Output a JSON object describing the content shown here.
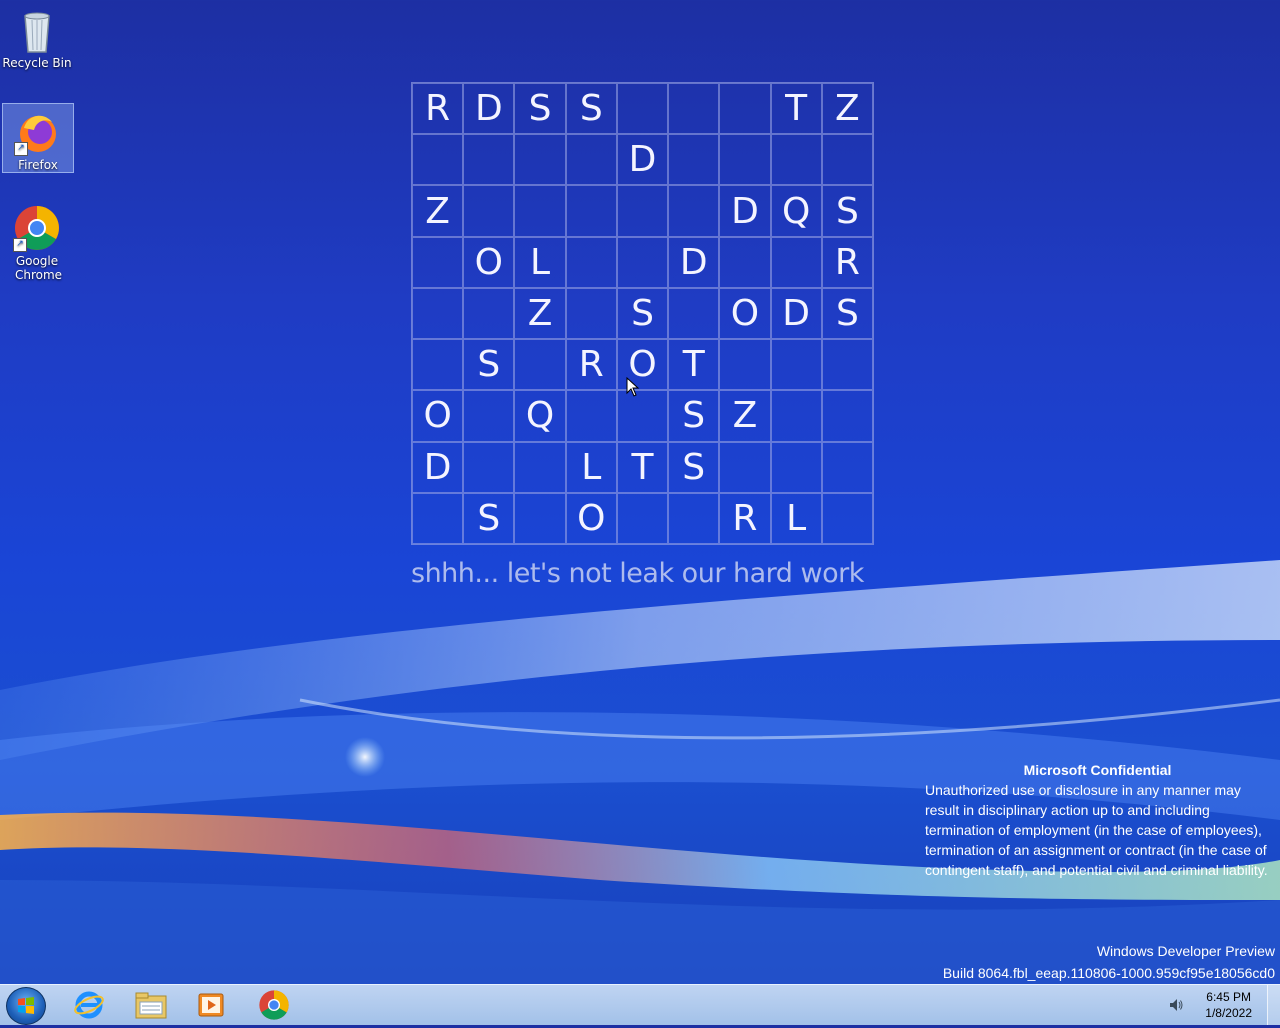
{
  "desktop": {
    "icons": [
      {
        "label": "Recycle Bin"
      },
      {
        "label": "Firefox"
      },
      {
        "label": "Google Chrome"
      }
    ]
  },
  "wallpaper": {
    "grid": [
      [
        "R",
        "D",
        "S",
        "S",
        "",
        "",
        "",
        "T",
        "Z"
      ],
      [
        "",
        "",
        "",
        "",
        "D",
        "",
        "",
        "",
        ""
      ],
      [
        "Z",
        "",
        "",
        "",
        "",
        "",
        "D",
        "Q",
        "S"
      ],
      [
        "",
        "O",
        "L",
        "",
        "",
        "D",
        "",
        "",
        "R"
      ],
      [
        "",
        "",
        "Z",
        "",
        "S",
        "",
        "O",
        "D",
        "S"
      ],
      [
        "",
        "S",
        "",
        "R",
        "O",
        "T",
        "",
        "",
        ""
      ],
      [
        "O",
        "",
        "Q",
        "",
        "",
        "S",
        "Z",
        "",
        ""
      ],
      [
        "D",
        "",
        "",
        "L",
        "T",
        "S",
        "",
        "",
        ""
      ],
      [
        "",
        "S",
        "",
        "O",
        "",
        "",
        "R",
        "L",
        ""
      ]
    ],
    "tagline": "shhh... let's not leak our hard work",
    "confidential_title": "Microsoft Confidential",
    "confidential_text": "Unauthorized use or disclosure in any manner may result in disciplinary action up to and including termination of employment (in the case of employees), termination of an assignment or contract (in the case of contingent staff), and potential civil and criminal liability.",
    "build_line1": "Windows Developer Preview",
    "build_line2": "Build 8064.fbl_eeap.110806-1000.959cf95e18056cd0"
  },
  "taskbar": {
    "pinned": [
      "internet-explorer",
      "windows-explorer",
      "media-player",
      "google-chrome"
    ],
    "clock_time": "6:45 PM",
    "clock_date": "1/8/2022"
  },
  "colors": {
    "background": "#1f3cc4",
    "grid_line": "#a0aae6",
    "taskbar": "#b8d2ef"
  }
}
